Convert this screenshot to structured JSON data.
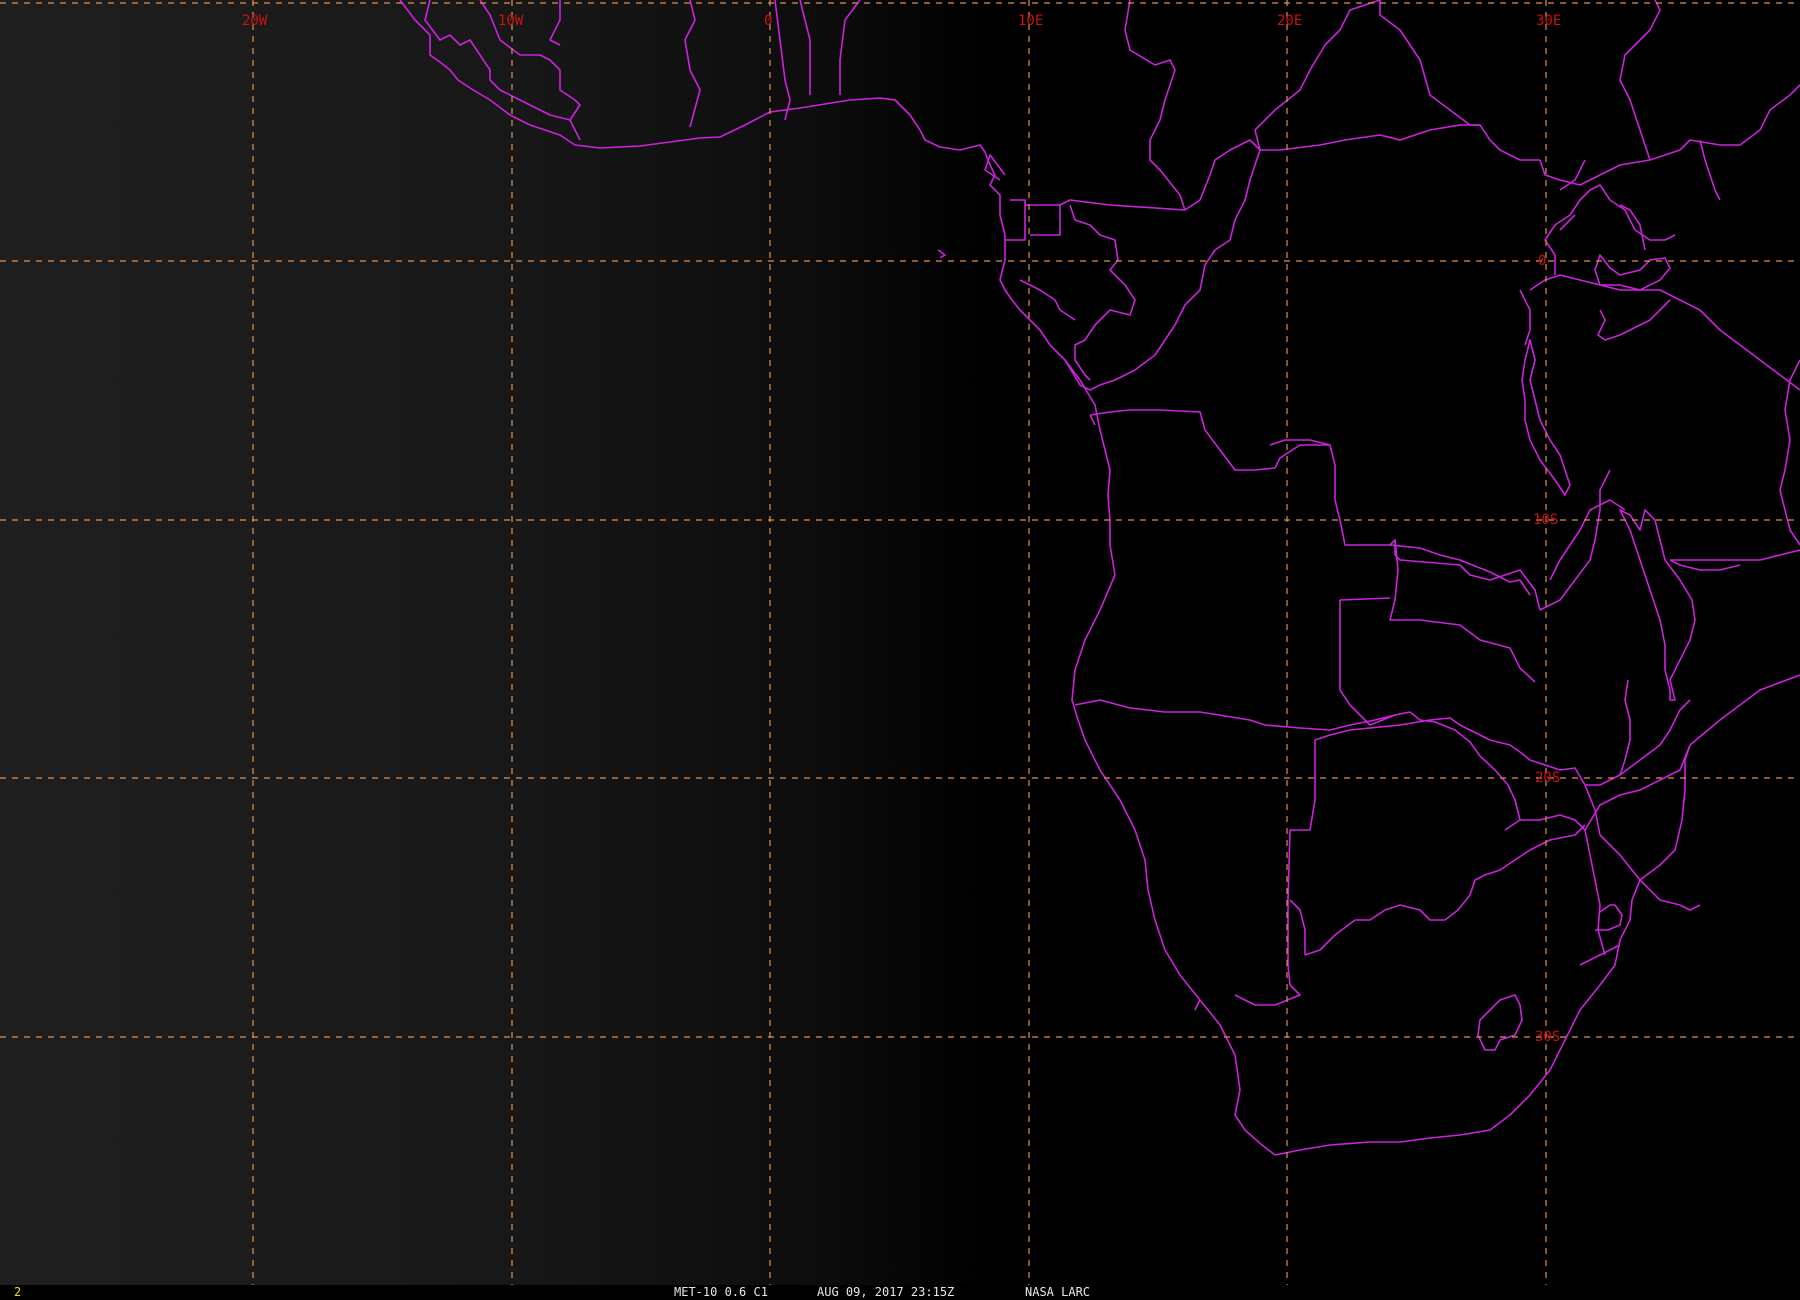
{
  "status_bar": {
    "frame_number": "2",
    "product": "MET-10 0.6 C1",
    "datetime": "AUG 09, 2017 23:15Z",
    "source": "NASA LARC"
  },
  "grid": {
    "longitude_labels": [
      "20W",
      "10W",
      "0",
      "10E",
      "20E",
      "30E"
    ],
    "latitude_labels": [
      "0",
      "10S",
      "20S",
      "30S"
    ]
  },
  "colors": {
    "background": "#000000",
    "boundaries": "#cc22dd",
    "grid": "#e0904a",
    "grid_labels": "#cc1111",
    "frame_number": "#e8e000"
  }
}
